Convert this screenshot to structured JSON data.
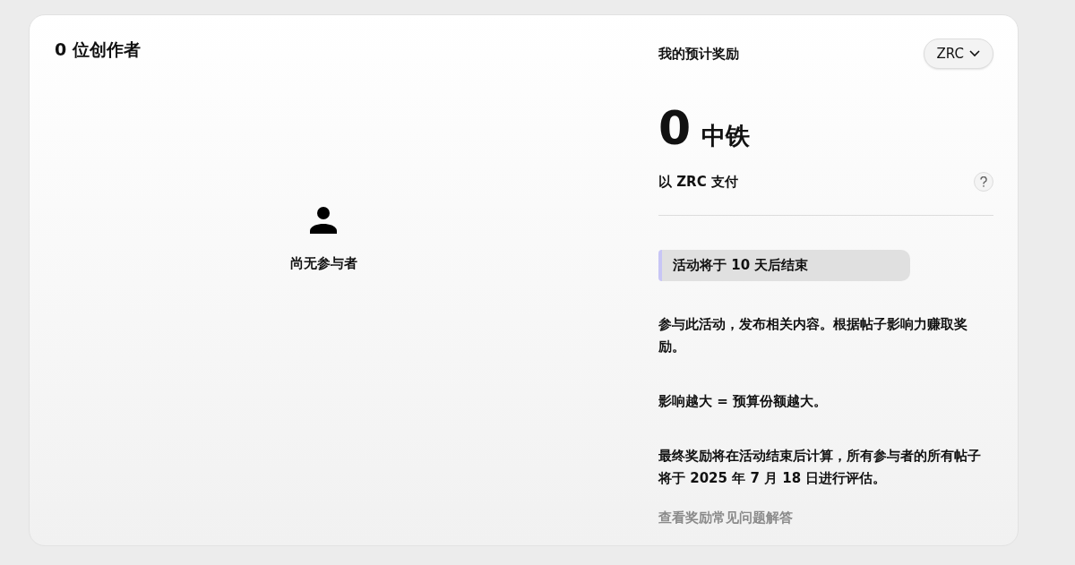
{
  "creators": {
    "heading": "0 位创作者",
    "empty_text": "尚无参与者"
  },
  "rewards": {
    "title": "我的预计奖励",
    "currency_selector": "ZRC",
    "amount": "0",
    "unit": "中铁",
    "payment_note": "以 ZRC 支付",
    "countdown": "活动将于 10 天后结束",
    "paragraphs": [
      "参与此活动，发布相关内容。根据帖子影响力赚取奖励。",
      "影响越大 = 预算份额越大。",
      "最终奖励将在活动结束后计算，所有参与者的所有帖子将于 2025 年 7 月 18 日进行评估。"
    ],
    "faq_link": "查看奖励常见问题解答"
  }
}
